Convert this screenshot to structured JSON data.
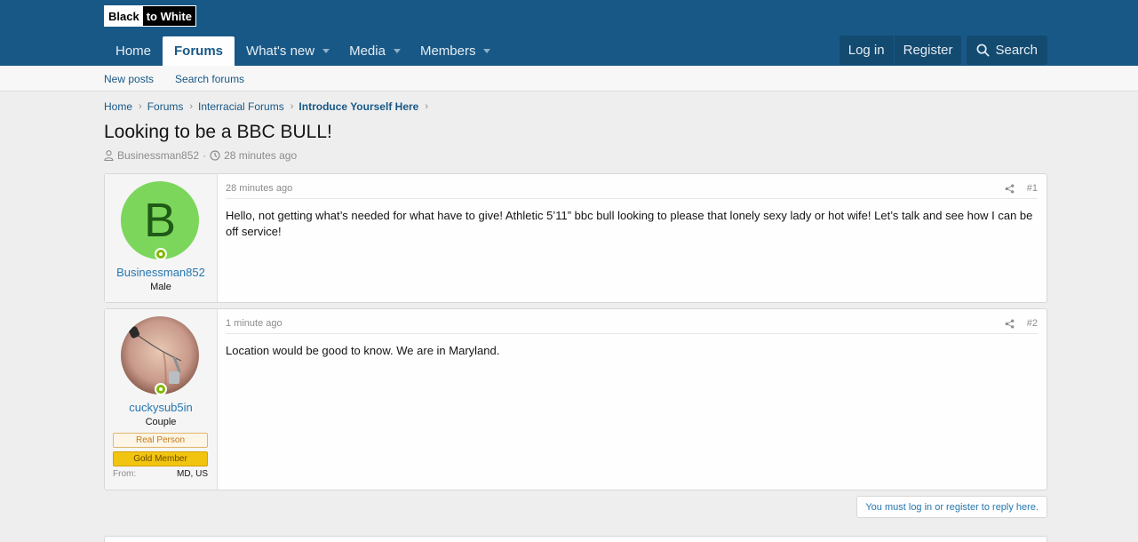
{
  "logo": {
    "part1": "Black",
    "part2": "to White"
  },
  "nav": {
    "items": [
      {
        "label": "Home",
        "active": false,
        "caret": false
      },
      {
        "label": "Forums",
        "active": true,
        "caret": false
      },
      {
        "label": "What's new",
        "active": false,
        "caret": true
      },
      {
        "label": "Media",
        "active": false,
        "caret": true
      },
      {
        "label": "Members",
        "active": false,
        "caret": true
      }
    ],
    "login_label": "Log in",
    "register_label": "Register",
    "search_label": "Search"
  },
  "subnav": {
    "new_posts": "New posts",
    "search_forums": "Search forums"
  },
  "breadcrumb": [
    "Home",
    "Forums",
    "Interracial Forums",
    "Introduce Yourself Here"
  ],
  "thread": {
    "title": "Looking to be a BBC BULL!",
    "author": "Businessman852",
    "sep": "·",
    "time": "28 minutes ago"
  },
  "posts": [
    {
      "avatar_letter": "B",
      "username": "Businessman852",
      "user_title": "Male",
      "time": "28 minutes ago",
      "number": "#1",
      "body": "Hello, not getting what’s needed for what have to give! Athletic 5’11” bbc bull looking to please that lonely sexy lady or hot wife! Let’s talk and see how I can be off service!"
    },
    {
      "username": "cuckysub5in",
      "user_title": "Couple",
      "banner_real": "Real Person",
      "banner_gold": "Gold Member",
      "from_label": "From:",
      "from_value": "MD, US",
      "time": "1 minute ago",
      "number": "#2",
      "body": "Location would be good to know. We are in Maryland."
    }
  ],
  "reply_notice": "You must log in or register to reply here.",
  "colors": {
    "header": "#185886",
    "link": "#2577b1",
    "avatar_bg": "#7cd65c",
    "online": "#7fb900"
  }
}
